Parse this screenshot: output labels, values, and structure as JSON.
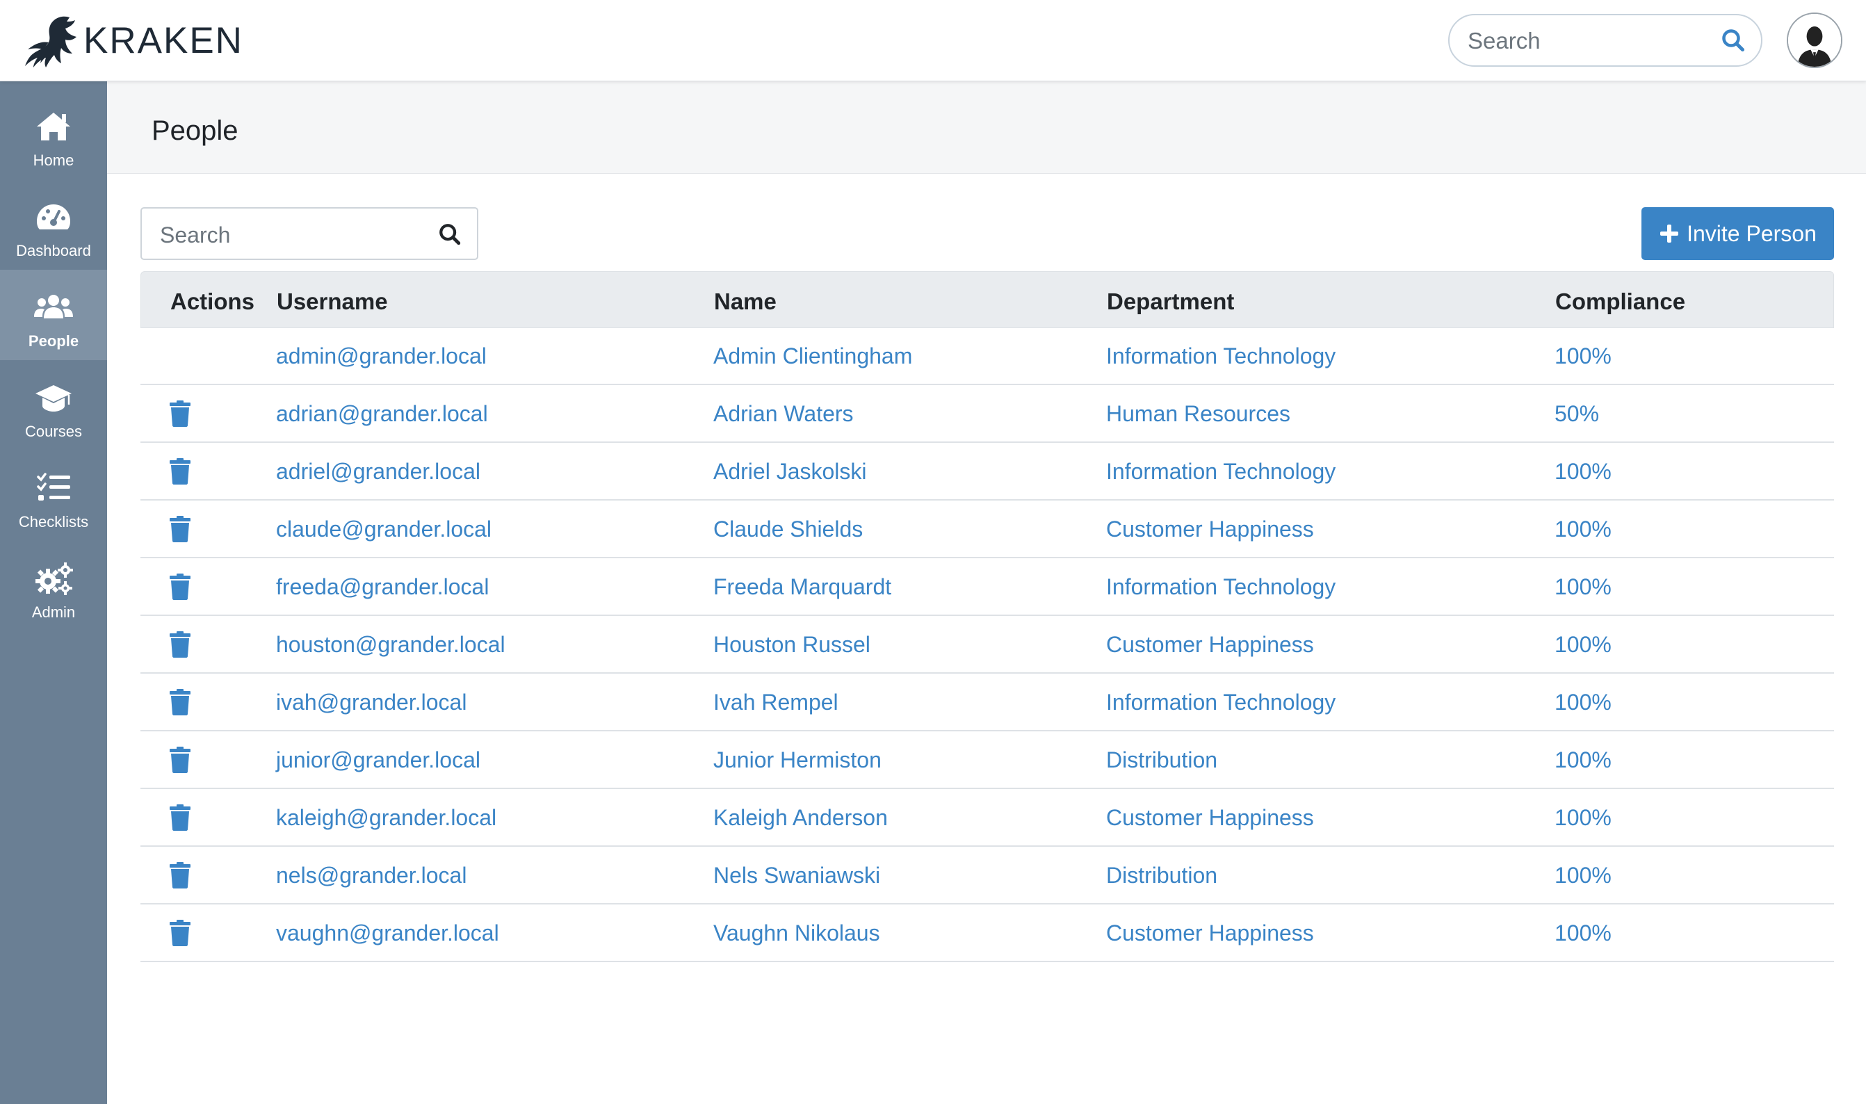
{
  "brand": {
    "name": "KRAKEN"
  },
  "topbar": {
    "search_placeholder": "Search"
  },
  "sidebar": {
    "items": [
      {
        "label": "Home",
        "icon": "home-icon"
      },
      {
        "label": "Dashboard",
        "icon": "dashboard-icon"
      },
      {
        "label": "People",
        "icon": "people-icon",
        "active": true
      },
      {
        "label": "Courses",
        "icon": "graduation-cap-icon"
      },
      {
        "label": "Checklists",
        "icon": "checklist-icon"
      },
      {
        "label": "Admin",
        "icon": "cogs-icon"
      }
    ]
  },
  "page": {
    "title": "People"
  },
  "table_search": {
    "placeholder": "Search"
  },
  "invite_button": {
    "label": "Invite Person"
  },
  "table": {
    "columns": [
      "Actions",
      "Username",
      "Name",
      "Department",
      "Compliance"
    ],
    "rows": [
      {
        "username": "admin@grander.local",
        "name": "Admin Clientingham",
        "department": "Information Technology",
        "compliance": "100%",
        "deletable": false
      },
      {
        "username": "adrian@grander.local",
        "name": "Adrian Waters",
        "department": "Human Resources",
        "compliance": "50%",
        "deletable": true
      },
      {
        "username": "adriel@grander.local",
        "name": "Adriel Jaskolski",
        "department": "Information Technology",
        "compliance": "100%",
        "deletable": true
      },
      {
        "username": "claude@grander.local",
        "name": "Claude Shields",
        "department": "Customer Happiness",
        "compliance": "100%",
        "deletable": true
      },
      {
        "username": "freeda@grander.local",
        "name": "Freeda Marquardt",
        "department": "Information Technology",
        "compliance": "100%",
        "deletable": true
      },
      {
        "username": "houston@grander.local",
        "name": "Houston Russel",
        "department": "Customer Happiness",
        "compliance": "100%",
        "deletable": true
      },
      {
        "username": "ivah@grander.local",
        "name": "Ivah Rempel",
        "department": "Information Technology",
        "compliance": "100%",
        "deletable": true
      },
      {
        "username": "junior@grander.local",
        "name": "Junior Hermiston",
        "department": "Distribution",
        "compliance": "100%",
        "deletable": true
      },
      {
        "username": "kaleigh@grander.local",
        "name": "Kaleigh Anderson",
        "department": "Customer Happiness",
        "compliance": "100%",
        "deletable": true
      },
      {
        "username": "nels@grander.local",
        "name": "Nels Swaniawski",
        "department": "Distribution",
        "compliance": "100%",
        "deletable": true
      },
      {
        "username": "vaughn@grander.local",
        "name": "Vaughn Nikolaus",
        "department": "Customer Happiness",
        "compliance": "100%",
        "deletable": true
      }
    ]
  },
  "colors": {
    "sidebar_bg": "#6a7f94",
    "sidebar_active": "#7f92a5",
    "link": "#3a84c6",
    "primary_button": "#3a84c6",
    "table_header_bg": "#e9ecef"
  }
}
